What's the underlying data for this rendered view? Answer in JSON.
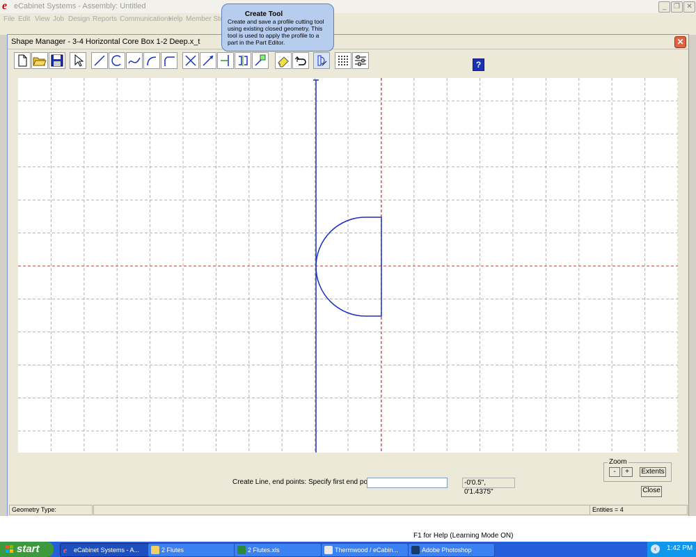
{
  "app": {
    "logo": "e",
    "title": "eCabinet Systems - Assembly: Untitled",
    "menu": [
      "File",
      "Edit",
      "View",
      "Job",
      "Design",
      "Reports",
      "Communications",
      "Help",
      "Member Store"
    ]
  },
  "dialog": {
    "title": "Shape Manager - 3-4 Horizontal Core Box 1-2 Deep.x_t",
    "close_glyph": "✕",
    "help_glyph": "?"
  },
  "toolbar": {
    "icons": [
      "new-file-icon",
      "open-folder-icon",
      "save-icon",
      "select-arrow-icon",
      "line-icon",
      "arc-icon",
      "curve-icon",
      "corner-arc-icon",
      "fillet-icon",
      "delete-x-icon",
      "extend-line-icon",
      "trim-icon",
      "offset-icon",
      "move-icon",
      "eraser-icon",
      "undo-icon",
      "create-tool-icon",
      "grid-icon",
      "settings-icon"
    ]
  },
  "tooltip": {
    "title": "Create Tool",
    "body": "Create and save a profile cutting tool using existing closed geometry. This tool is used to apply the profile to a part in the Part Editor."
  },
  "command": {
    "prompt": "Create Line, end points: Specify first end point (X,Y):",
    "input_value": "",
    "coordinates": "-0'0.5\", 0'1.4375\""
  },
  "zoom": {
    "label": "Zoom",
    "minus": "-",
    "plus": "+",
    "extents": "Extents"
  },
  "close_button": "Close",
  "status": {
    "geometry_type": "Geometry Type:",
    "entities": "Entities = 4"
  },
  "help_status": "F1 for Help (Learning Mode ON)",
  "taskbar": {
    "start": "start",
    "items": [
      {
        "label": "eCabinet Systems - A...",
        "icon": "ecabinet-icon"
      },
      {
        "label": "2 Flutes",
        "icon": "folder-icon"
      },
      {
        "label": "2 Flutes.xls",
        "icon": "excel-icon"
      },
      {
        "label": "Thermwood / eCabin...",
        "icon": "browser-icon"
      },
      {
        "label": "Adobe Photoshop",
        "icon": "photoshop-icon"
      }
    ],
    "clock": "1:42 PM"
  },
  "colors": {
    "grid": "#b0b0b0",
    "shape": "#1a2fbf",
    "axis_x": "#d03030",
    "axis_y": "#1a2fbf"
  }
}
